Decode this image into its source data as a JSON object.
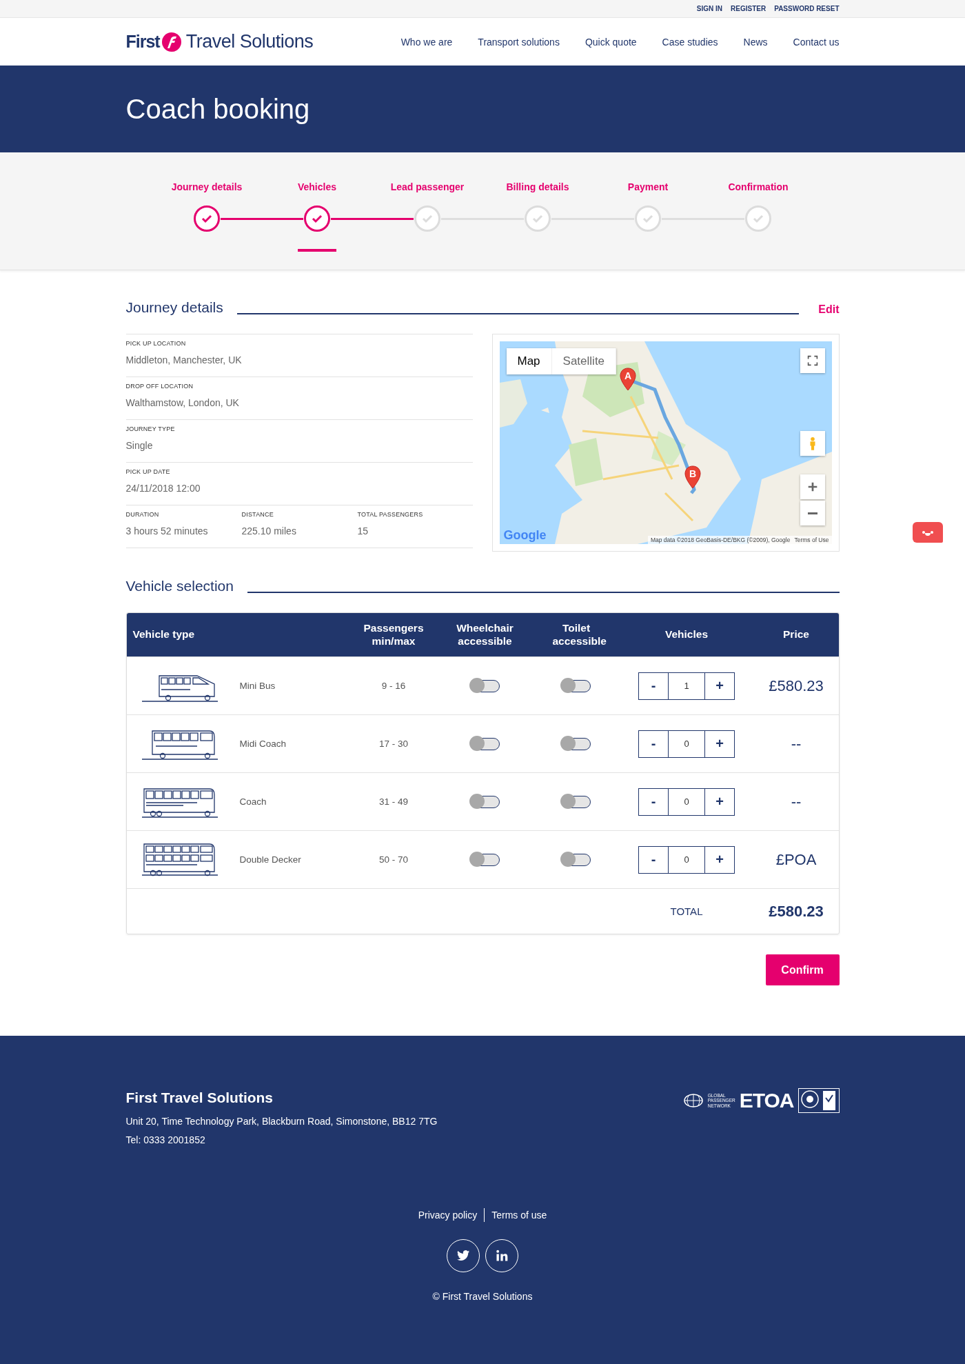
{
  "top_links": [
    "SIGN IN",
    "REGISTER",
    "PASSWORD RESET"
  ],
  "logo": {
    "brand": "First",
    "name": "Travel Solutions"
  },
  "nav": [
    "Who we are",
    "Transport solutions",
    "Quick quote",
    "Case studies",
    "News",
    "Contact us"
  ],
  "page_title": "Coach booking",
  "steps": [
    {
      "label": "Journey details",
      "completed": true,
      "selected": false
    },
    {
      "label": "Vehicles",
      "completed": true,
      "selected": true
    },
    {
      "label": "Lead passenger",
      "completed": false,
      "selected": false
    },
    {
      "label": "Billing details",
      "completed": false,
      "selected": false
    },
    {
      "label": "Payment",
      "completed": false,
      "selected": false
    },
    {
      "label": "Confirmation",
      "completed": false,
      "selected": false
    }
  ],
  "journey": {
    "title": "Journey details",
    "edit": "Edit",
    "fields": [
      {
        "label": "PICK UP LOCATION",
        "value": "Middleton, Manchester, UK"
      },
      {
        "label": "DROP OFF LOCATION",
        "value": "Walthamstow, London, UK"
      },
      {
        "label": "JOURNEY TYPE",
        "value": "Single"
      },
      {
        "label": "PICK UP DATE",
        "value": "24/11/2018 12:00"
      }
    ],
    "stats": [
      {
        "label": "DURATION",
        "value": "3 hours 52 minutes"
      },
      {
        "label": "DISTANCE",
        "value": "225.10 miles"
      },
      {
        "label": "TOTAL PASSENGERS",
        "value": "15"
      }
    ],
    "map": {
      "kind": "picture",
      "tabs": [
        {
          "label": "Map",
          "selected": true
        },
        {
          "label": "Satellite",
          "selected": false
        }
      ],
      "pins": [
        "A",
        "B"
      ],
      "logo": "Google",
      "attribution": "Map data ©2018 GeoBasis-DE/BKG (©2009), Google",
      "terms": "Terms of Use"
    }
  },
  "vehicles": {
    "title": "Vehicle selection",
    "columns": [
      "Vehicle type",
      "Passengers min/max",
      "Wheelchair accessible",
      "Toilet accessible",
      "Vehicles",
      "Price"
    ],
    "rows": [
      {
        "kind": "minibus",
        "name": "Mini Bus",
        "passengers": "9 - 16",
        "wheelchair": false,
        "toilet": false,
        "minus": "-",
        "count": "1",
        "plus": "+",
        "price": "£580.23"
      },
      {
        "kind": "midi",
        "name": "Midi Coach",
        "passengers": "17 - 30",
        "wheelchair": false,
        "toilet": false,
        "minus": "-",
        "count": "0",
        "plus": "+",
        "price": "--"
      },
      {
        "kind": "coach",
        "name": "Coach",
        "passengers": "31 - 49",
        "wheelchair": false,
        "toilet": false,
        "minus": "-",
        "count": "0",
        "plus": "+",
        "price": "--"
      },
      {
        "kind": "double",
        "name": "Double Decker",
        "passengers": "50 - 70",
        "wheelchair": false,
        "toilet": false,
        "minus": "-",
        "count": "0",
        "plus": "+",
        "price": "£POA"
      }
    ],
    "total_label": "TOTAL",
    "total": "£580.23"
  },
  "confirm": "Confirm",
  "footer": {
    "company": "First Travel Solutions",
    "address": "Unit 20, Time Technology Park, Blackburn Road, Simonstone, BB12 7TG",
    "phone": "Tel: 0333 2001852",
    "partners": {
      "gpn": "GLOBAL PASSENGER NETWORK",
      "etoa": "ETOA"
    },
    "links": [
      "Privacy policy",
      "Terms of use"
    ],
    "copyright": "© First Travel Solutions"
  }
}
